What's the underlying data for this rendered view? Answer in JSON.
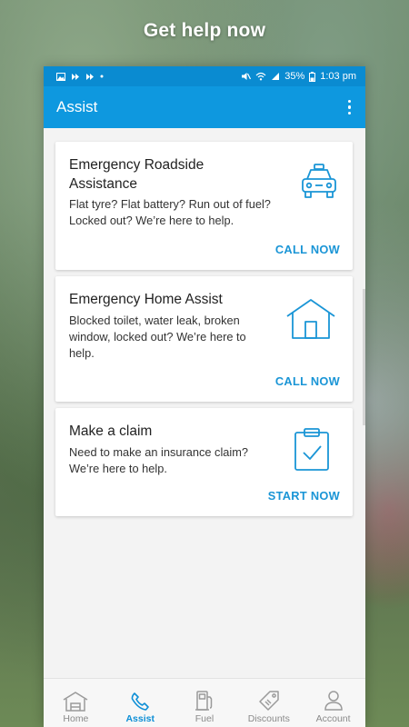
{
  "headline": "Get help now",
  "status_bar": {
    "battery": "35%",
    "time": "1:03 pm"
  },
  "app_bar": {
    "title": "Assist"
  },
  "cards": [
    {
      "title": "Emergency Roadside Assistance",
      "description": "Flat tyre? Flat battery? Run out of fuel? Locked out? We’re here to help.",
      "action": "CALL NOW",
      "icon": "taxi-icon"
    },
    {
      "title": "Emergency Home Assist",
      "description": "Blocked toilet, water leak, broken window, locked out? We’re here to help.",
      "action": "CALL NOW",
      "icon": "house-icon"
    },
    {
      "title": "Make a claim",
      "description": "Need to make an insurance claim? We’re here to help.",
      "action": "START NOW",
      "icon": "clipboard-check-icon"
    }
  ],
  "bottom_nav": [
    {
      "label": "Home",
      "icon": "home-icon",
      "active": false
    },
    {
      "label": "Assist",
      "icon": "phone-icon",
      "active": true
    },
    {
      "label": "Fuel",
      "icon": "fuel-pump-icon",
      "active": false
    },
    {
      "label": "Discounts",
      "icon": "tag-icon",
      "active": false
    },
    {
      "label": "Account",
      "icon": "user-icon",
      "active": false
    }
  ],
  "colors": {
    "primary": "#0e98df",
    "status_bar": "#0a8bd1",
    "accent": "#1a95d6"
  }
}
